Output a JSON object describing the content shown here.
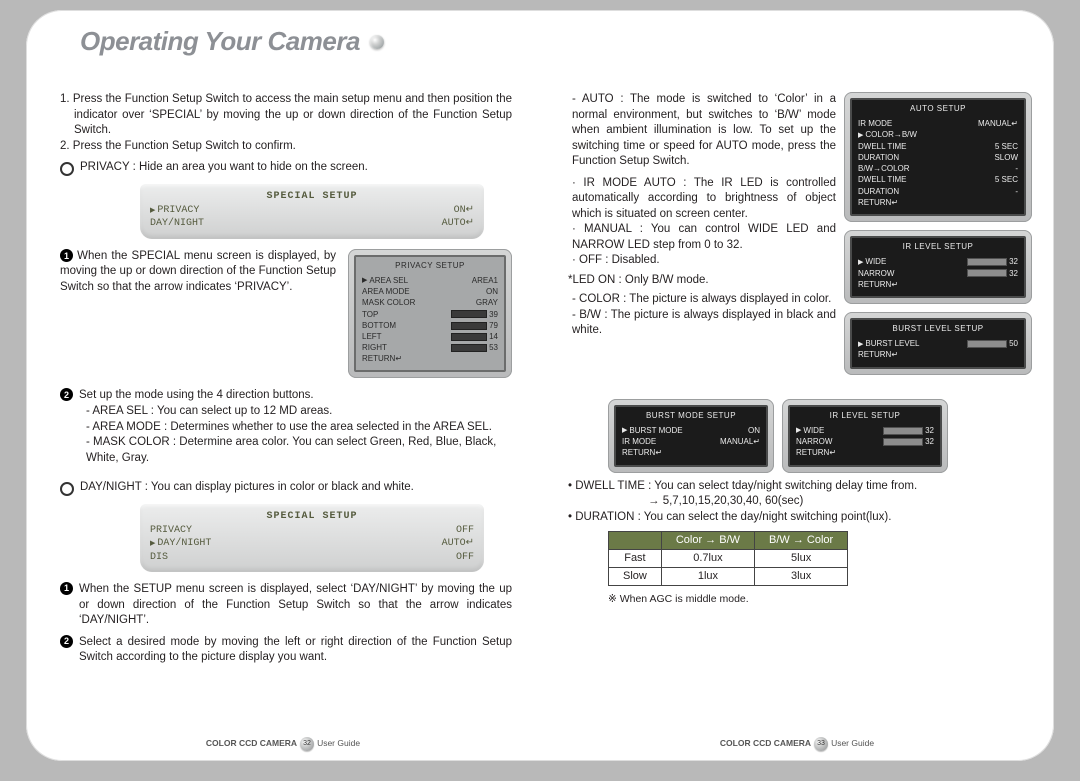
{
  "title": "Operating Your Camera",
  "left": {
    "step1": "1. Press the Function Setup Switch to access the main setup menu and then position the indicator over ‘SPECIAL’ by moving the up or down direction of the Function Setup Switch.",
    "step2": "2. Press the Function Setup Switch to confirm.",
    "privacy_label": "PRIVACY : Hide an area you want to hide on the screen.",
    "panel1": {
      "title": "SPECIAL SETUP",
      "row1_l": "PRIVACY",
      "row1_r": "ON↵",
      "row2_l": "DAY/NIGHT",
      "row2_r": "AUTO↵"
    },
    "p1_text": "When the SPECIAL menu screen is displayed, by moving the up or down direction of the Function Setup Switch so that the arrow indicates ‘PRIVACY’.",
    "privacy_tv": {
      "title": "PRIVACY SETUP",
      "row1_l": "AREA SEL",
      "row1_r": "AREA1",
      "row2_l": "AREA MODE",
      "row2_r": "ON",
      "row3_l": "MASK COLOR",
      "row3_r": "GRAY",
      "row4_l": "TOP",
      "row4_r": "39",
      "row5_l": "BOTTOM",
      "row5_r": "79",
      "row6_l": "LEFT",
      "row6_r": "14",
      "row7_l": "RIGHT",
      "row7_r": "53",
      "row8_l": "RETURN↵"
    },
    "p2_intro": "Set up the mode using the 4 direction buttons.",
    "p2_a": "- AREA SEL : You can select up to 12 MD areas.",
    "p2_b": "- AREA MODE : Determines whether to use the area selected in the AREA SEL.",
    "p2_c": "- MASK COLOR : Determine area color. You can select Green, Red, Blue, Black, White, Gray.",
    "daynight_label": "DAY/NIGHT : You can display pictures in color or black and white.",
    "panel2": {
      "title": "SPECIAL SETUP",
      "row1_l": "PRIVACY",
      "row1_r": "OFF",
      "row2_l": "DAY/NIGHT",
      "row2_r": "AUTO↵",
      "row3_l": "DIS",
      "row3_r": "OFF"
    },
    "dn1": "When the SETUP menu screen is displayed, select ‘DAY/NIGHT’ by moving the up or down direction of the Function Setup Switch so that the arrow indicates ‘DAY/NIGHT’.",
    "dn2": "Select a desired mode by moving the left or right direction of the Function Setup Switch according to the picture display you want."
  },
  "right": {
    "auto": "- AUTO : The mode is switched to ‘Color’ in a normal environment, but switches to ‘B/W’ mode when ambient illumination is low. To set up the switching time or speed for AUTO mode, press the Function Setup Switch.",
    "ir_auto": "· IR MODE AUTO : The IR LED is controlled automatically according to brightness of object which is situated on screen center.",
    "ir_manual": "· MANUAL : You can control WIDE LED and NARROW LED step from 0 to 32.",
    "ir_off": "· OFF : Disabled.",
    "led_on": "*LED ON : Only B/W mode.",
    "color": "- COLOR : The picture is always displayed in color.",
    "bw": "- B/W : The picture is always displayed in black and white.",
    "tv_auto_setup": {
      "title": "AUTO SETUP",
      "r1l": "IR MODE",
      "r1r": "MANUAL↵",
      "r2l": "COLOR→B/W",
      "r3l": "DWELL TIME",
      "r3r": "5 SEC",
      "r4l": "DURATION",
      "r4r": "SLOW",
      "r5l": "B/W→COLOR",
      "r5r": "-",
      "r6l": "DWELL TIME",
      "r6r": "5 SEC",
      "r7l": "DURATION",
      "r7r": "-",
      "r8l": "RETURN↵"
    },
    "tv_ir_level": {
      "title": "IR LEVEL SETUP",
      "r1l": "WIDE",
      "r1r": "32",
      "r2l": "NARROW",
      "r2r": "32",
      "r3l": "RETURN↵"
    },
    "tv_burst_level": {
      "title": "BURST LEVEL SETUP",
      "r1l": "BURST LEVEL",
      "r1r": "50",
      "r2l": "RETURN↵"
    },
    "tv_burst_mode": {
      "title": "BURST MODE SETUP",
      "r1l": "BURST MODE",
      "r1r": "ON",
      "r2l": "IR MODE",
      "r2r": "MANUAL↵",
      "r3l": "RETURN↵"
    },
    "tv_ir_level2": {
      "title": "IR LEVEL SETUP",
      "r1l": "WIDE",
      "r1r": "32",
      "r2l": "NARROW",
      "r2r": "32",
      "r3l": "RETURN↵"
    },
    "dwell": "• DWELL TIME : You can select tday/night switching delay time from.",
    "dwell_opts": "→ 5,7,10,15,20,30,40, 60(sec)",
    "duration": "• DURATION : You can select the day/night switching point(lux).",
    "table": {
      "h0": "",
      "h1": "Color → B/W",
      "h2": "B/W → Color",
      "r1_h": "Fast",
      "r1_a": "0.7lux",
      "r1_b": "5lux",
      "r2_h": "Slow",
      "r2_a": "1lux",
      "r2_b": "3lux"
    },
    "note": "※ When AGC is middle mode."
  },
  "footer": {
    "brand_l": "COLOR CCD CAMERA",
    "page_l": "32",
    "guide_l": "User Guide",
    "brand_r": "COLOR CCD CAMERA",
    "page_r": "33",
    "guide_r": "User Guide"
  }
}
